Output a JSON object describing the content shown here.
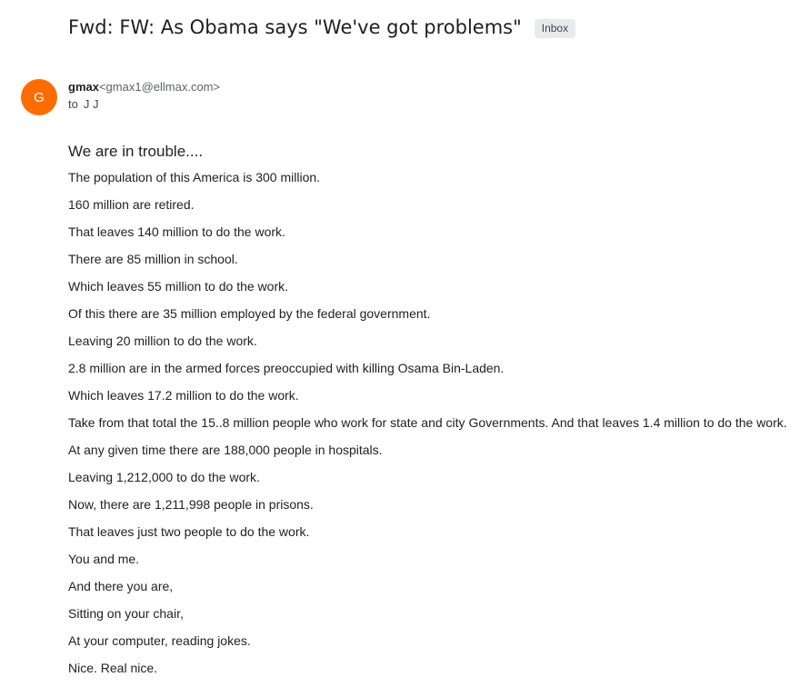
{
  "email": {
    "subject": "Fwd: FW: As Obama says \"We've got problems\"",
    "label": "Inbox",
    "sender": {
      "avatar_letter": "G",
      "avatar_color": "#ff6d00",
      "name": "gmax",
      "email": "<gmax1@ellmax.com>"
    },
    "to_prefix": "to",
    "to_name": "J J",
    "greeting": "We are in trouble....",
    "body_lines": [
      "The population of this America is 300 million.",
      "160 million are retired.",
      "That leaves 140 million to do the work.",
      "There are 85 million in school.",
      "Which leaves 55 million to do the work.",
      "Of this there are 35 million employed by the federal government.",
      "Leaving 20 million to do the work.",
      "2.8 million are in the armed forces preoccupied with killing Osama Bin-Laden.",
      "Which leaves 17.2 million to do the work.",
      "Take from that total the 15..8 million people who work for state and city Governments. And that leaves 1.4 million to do the work.",
      "At any given time there are 188,000 people in hospitals.",
      "Leaving 1,212,000 to do the work.",
      "Now, there are 1,211,998 people in prisons.",
      "That leaves just two people to do the work.",
      "You and me.",
      "And there you are,",
      "Sitting on your chair,",
      "At your computer, reading jokes.",
      "Nice. Real nice."
    ]
  }
}
